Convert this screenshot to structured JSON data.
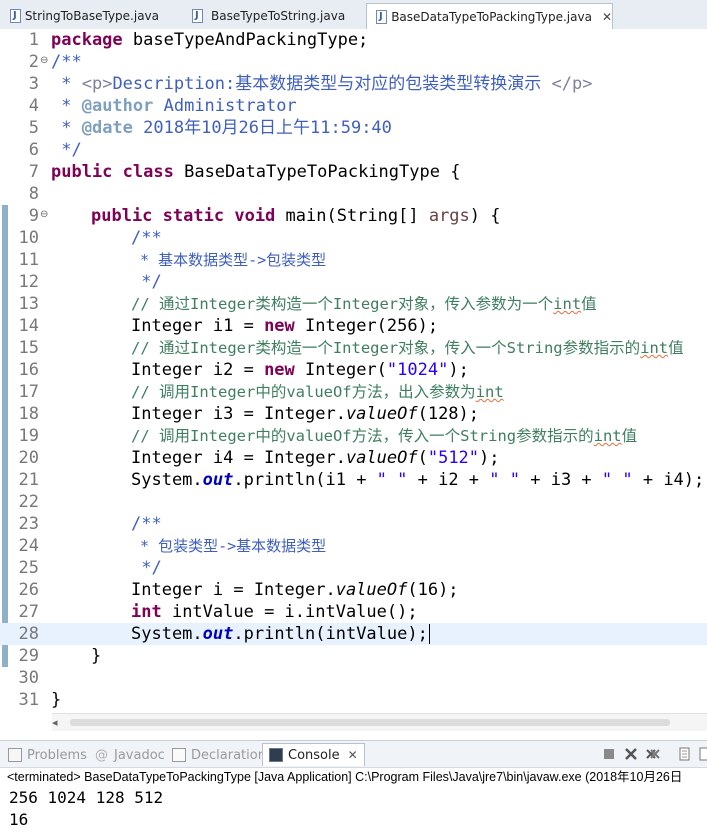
{
  "editor_tabs": [
    {
      "label": "StringToBaseType.java",
      "active": false
    },
    {
      "label": "BaseTypeToString.java",
      "active": false
    },
    {
      "label": "BaseDataTypeToPackingType.java",
      "active": true,
      "close": "✕"
    }
  ],
  "code_lines": [
    {
      "n": "1"
    },
    {
      "n": "2",
      "fold": "⊖"
    },
    {
      "n": "3"
    },
    {
      "n": "4"
    },
    {
      "n": "5"
    },
    {
      "n": "6"
    },
    {
      "n": "7"
    },
    {
      "n": "8"
    },
    {
      "n": "9",
      "fold": "⊖"
    },
    {
      "n": "10"
    },
    {
      "n": "11"
    },
    {
      "n": "12"
    },
    {
      "n": "13"
    },
    {
      "n": "14"
    },
    {
      "n": "15"
    },
    {
      "n": "16"
    },
    {
      "n": "17"
    },
    {
      "n": "18"
    },
    {
      "n": "19"
    },
    {
      "n": "20"
    },
    {
      "n": "21"
    },
    {
      "n": "22"
    },
    {
      "n": "23"
    },
    {
      "n": "24"
    },
    {
      "n": "25"
    },
    {
      "n": "26"
    },
    {
      "n": "27"
    },
    {
      "n": "28"
    },
    {
      "n": "29"
    },
    {
      "n": "30"
    },
    {
      "n": "31"
    }
  ],
  "code": {
    "l1_kw": "package",
    "l1_rest": " baseTypeAndPackingType;",
    "l2": "/**",
    "l3_a": " * ",
    "l3_b": "<p>",
    "l3_c": "Description:基本数据类型与对应的包装类型转换演示 ",
    "l3_d": "</p>",
    "l4_a": " * ",
    "l4_b": "@author",
    "l4_c": " Administrator",
    "l5_a": " * ",
    "l5_b": "@date",
    "l5_c": " 2018年10月26日上午11:59:40",
    "l6": " */",
    "l7_kw1": "public",
    "l7_kw2": "class",
    "l7_rest": " BaseDataTypeToPackingType {",
    "l9_kw1": "public",
    "l9_kw2": "static",
    "l9_kw3": "void",
    "l9_a": " main(String[] ",
    "l9_param": "args",
    "l9_b": ") {",
    "l10": "/**",
    "l11": " * 基本数据类型->包装类型",
    "l12": " */",
    "l13_a": "// 通过Integer类构造一个Integer对象，传入参数为一个",
    "l13_sq": "int",
    "l13_b": "值",
    "l14_a": "Integer i1 = ",
    "l14_kw": "new",
    "l14_b": " Integer(256);",
    "l15_a": "// 通过Integer类构造一个Integer对象，传入一个String参数指示的",
    "l15_sq": "int",
    "l15_b": "值",
    "l16_a": "Integer i2 = ",
    "l16_kw": "new",
    "l16_b": " Integer(",
    "l16_str": "\"1024\"",
    "l16_c": ");",
    "l17_a": "// 调用Integer中的valueOf方法，出入参数为",
    "l17_sq": "int",
    "l18_a": "Integer i3 = Integer.",
    "l18_m": "valueOf",
    "l18_b": "(128);",
    "l19_a": "// 调用Integer中的valueOf方法，传入一个String参数指示的",
    "l19_sq": "int",
    "l19_b": "值",
    "l20_a": "Integer i4 = Integer.",
    "l20_m": "valueOf",
    "l20_b": "(",
    "l20_str": "\"512\"",
    "l20_c": ");",
    "l21_a": "System.",
    "l21_f": "out",
    "l21_b": ".println(i1 + ",
    "l21_s1": "\" \"",
    "l21_c": " + i2 + ",
    "l21_s2": "\" \"",
    "l21_d": " + i3 + ",
    "l21_s3": "\" \"",
    "l21_e": " + i4);",
    "l23": "/**",
    "l24": " * 包装类型->基本数据类型",
    "l25": " */",
    "l26_a": "Integer i = Integer.",
    "l26_m": "valueOf",
    "l26_b": "(16);",
    "l27_kw": "int",
    "l27_b": " intValue = i.intValue();",
    "l28_a": "System.",
    "l28_f": "out",
    "l28_b": ".println(intValue);",
    "l29": "}",
    "l31": "}"
  },
  "scroll_left_arrow": "◂",
  "panel": {
    "tabs": [
      {
        "label": "Problems",
        "active": false
      },
      {
        "label": "Javadoc",
        "prefix": "@",
        "active": false
      },
      {
        "label": "Declaration",
        "active": false
      },
      {
        "label": "Console",
        "active": true,
        "close": "✕"
      }
    ],
    "status": "<terminated> BaseDataTypeToPackingType [Java Application] C:\\Program Files\\Java\\jre7\\bin\\javaw.exe (2018年10月26日",
    "output": [
      "256 1024 128 512",
      "16"
    ]
  },
  "colors": {
    "keyword": "#7f0055",
    "comment": "#3f7f5f",
    "javadoc": "#3f5fbf",
    "string": "#2a00ff",
    "field": "#0000c0",
    "current_line": "#e8f2fe"
  }
}
